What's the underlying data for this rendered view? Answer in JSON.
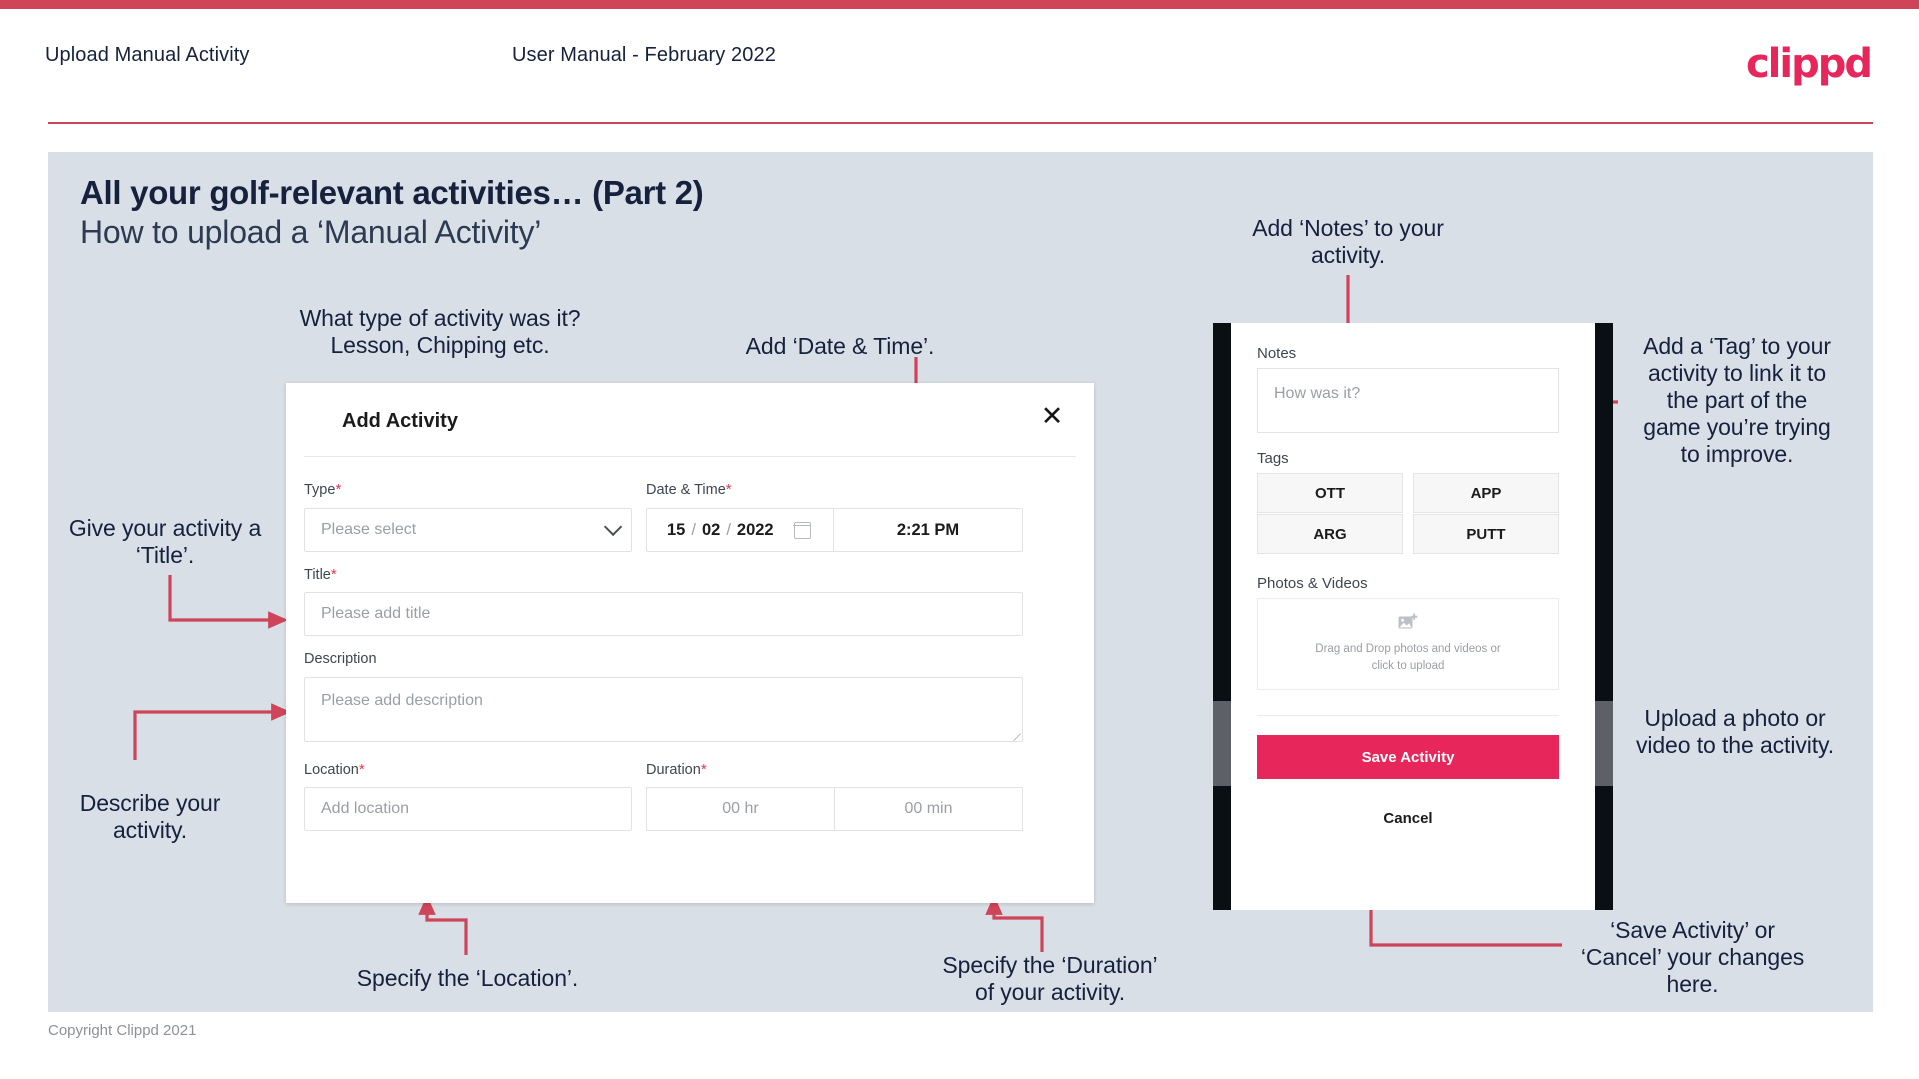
{
  "header": {
    "left_title": "Upload Manual Activity",
    "center_title": "User Manual - February 2022",
    "logo_text": "clippd"
  },
  "slide": {
    "title_main": "All your golf-relevant activities… (Part 2)",
    "title_sub": "How to upload a ‘Manual Activity’"
  },
  "annotations": {
    "type": "What type of activity was it?\nLesson, Chipping etc.",
    "datetime": "Add ‘Date & Time’.",
    "title": "Give your activity a\n‘Title’.",
    "description": "Describe your\nactivity.",
    "location": "Specify the ‘Location’.",
    "duration": "Specify the ‘Duration’\nof your activity.",
    "notes": "Add ‘Notes’ to your\nactivity.",
    "tags": "Add a ‘Tag’ to your\nactivity to link it to\nthe part of the\ngame you’re trying\nto improve.",
    "photos": "Upload a photo or\nvideo to the activity.",
    "save_cancel": "‘Save Activity’ or\n‘Cancel’ your changes\nhere."
  },
  "dialog": {
    "title": "Add Activity",
    "close_icon": "close-icon",
    "fields": {
      "type_label": "Type",
      "type_placeholder": "Please select",
      "datetime_label": "Date & Time",
      "date_day": "15",
      "date_month": "02",
      "date_year": "2022",
      "date_sep": "/",
      "time_value": "2:21 PM",
      "title_label": "Title",
      "title_placeholder": "Please add title",
      "description_label": "Description",
      "description_placeholder": "Please add description",
      "location_label": "Location",
      "location_placeholder": "Add location",
      "duration_label": "Duration",
      "duration_hr_placeholder": "00 hr",
      "duration_min_placeholder": "00 min"
    },
    "required_marker": "*"
  },
  "phone": {
    "notes_label": "Notes",
    "notes_placeholder": "How was it?",
    "tags_label": "Tags",
    "tags": [
      "OTT",
      "APP",
      "ARG",
      "PUTT"
    ],
    "photos_label": "Photos & Videos",
    "dropzone_text": "Drag and Drop photos and videos or\nclick to upload",
    "dropzone_icon": "image-add-icon",
    "save_label": "Save Activity",
    "cancel_label": "Cancel"
  },
  "footer": {
    "copyright": "Copyright Clippd 2021"
  },
  "colors": {
    "brand_pink": "#e7265b",
    "top_bar": "#cf4458",
    "slide_bg": "#d9dfe6",
    "annotation_line": "#cf4458",
    "text_navy": "#16213e"
  }
}
